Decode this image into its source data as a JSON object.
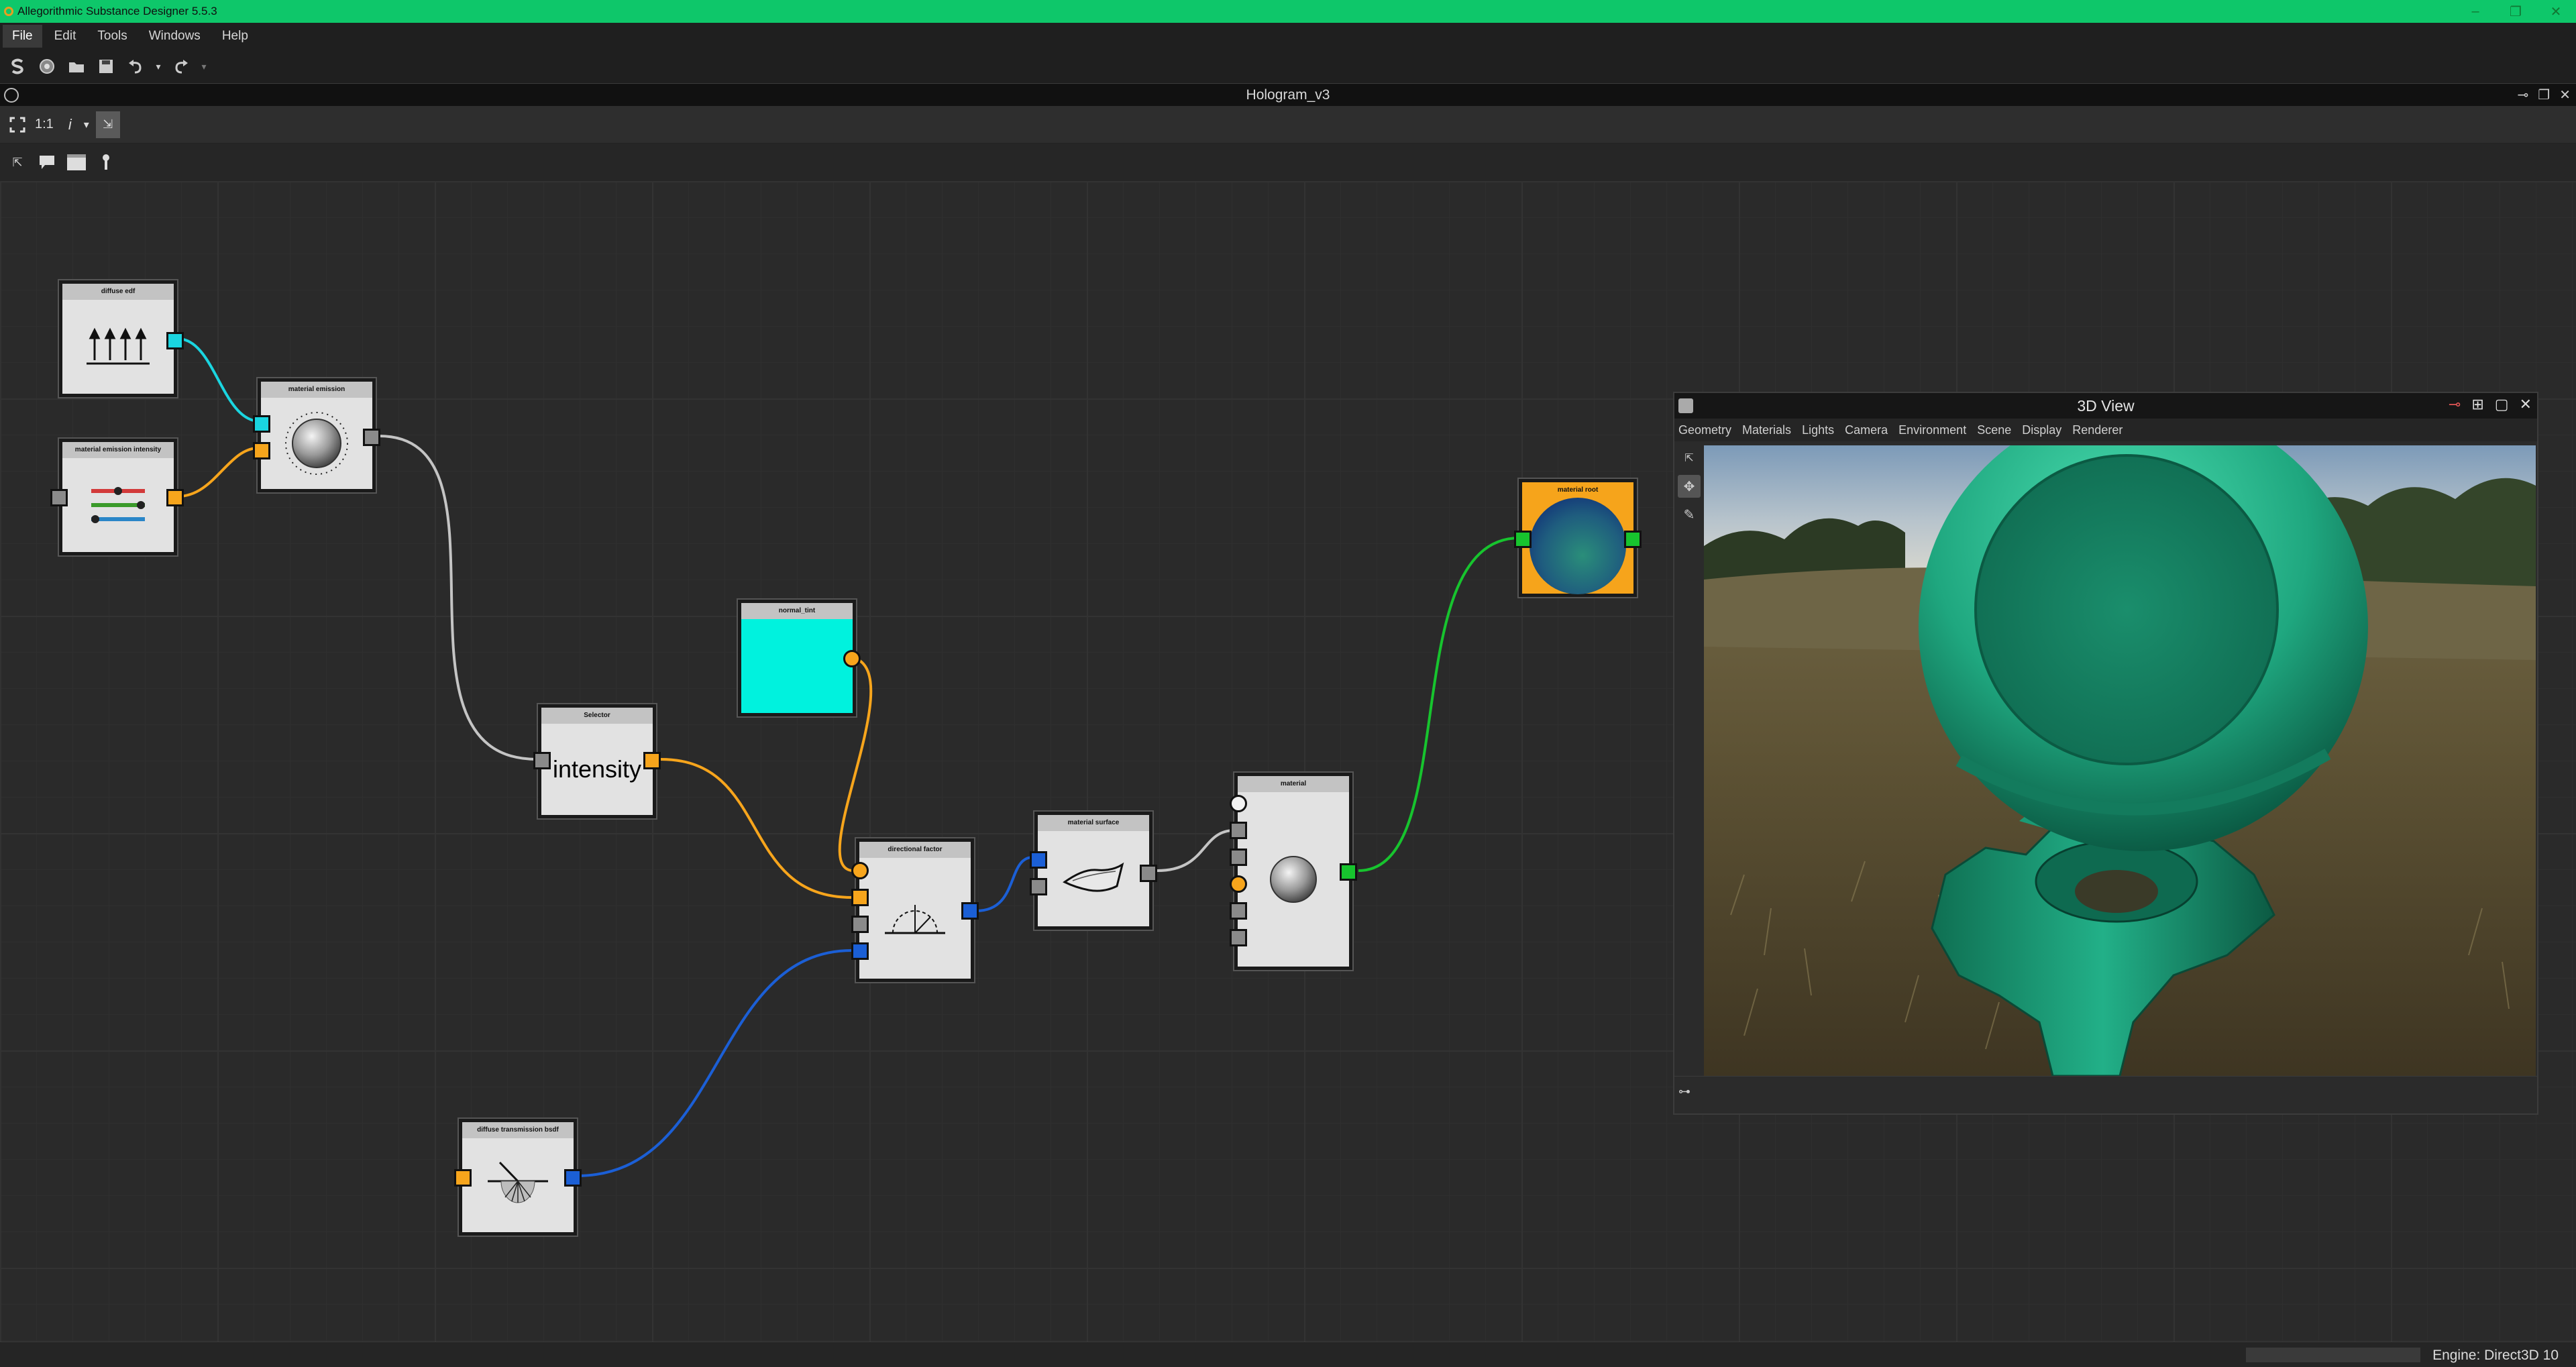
{
  "window": {
    "title": "Allegorithmic Substance Designer 5.5.3",
    "controls": [
      "minimize",
      "restore",
      "close"
    ]
  },
  "menu": [
    {
      "label": "File",
      "active": true
    },
    {
      "label": "Edit"
    },
    {
      "label": "Tools"
    },
    {
      "label": "Windows"
    },
    {
      "label": "Help"
    }
  ],
  "toolbar": {
    "icons": [
      "substance-icon",
      "package-icon",
      "open-folder-icon",
      "save-icon",
      "save-all-icon",
      "undo-icon",
      "redo-icon"
    ]
  },
  "document": {
    "title": "Hologram_v3"
  },
  "graph_toolbar": {
    "zoom_label": "1:1",
    "info_label": "i"
  },
  "nodes": {
    "diffuse_edf": {
      "title": "diffuse edf"
    },
    "material_emission": {
      "title": "material emission"
    },
    "material_emission_intensity": {
      "title": "material emission intensity"
    },
    "selector": {
      "title": "Selector",
      "body_text": "intensity"
    },
    "normal_tint": {
      "title": "normal_tint",
      "color": "#00f2de"
    },
    "material_root": {
      "title": "material root"
    },
    "directional_factor": {
      "title": "directional factor"
    },
    "material_surface": {
      "title": "material surface"
    },
    "material": {
      "title": "material"
    },
    "diffuse_transmission_bsdf": {
      "title": "diffuse transmission bsdf"
    }
  },
  "wire_colors": {
    "color": "#1ad5e0",
    "float": "#f7a51c",
    "edf": "#b8b8b8",
    "bsdf": "#1b5fd6",
    "material": "#17c42e"
  },
  "view3d": {
    "title": "3D View",
    "menu": [
      "Geometry",
      "Materials",
      "Lights",
      "Camera",
      "Environment",
      "Scene",
      "Display",
      "Renderer"
    ],
    "shader_color": "#1fa77f"
  },
  "status": {
    "engine": "Engine: Direct3D 10"
  }
}
